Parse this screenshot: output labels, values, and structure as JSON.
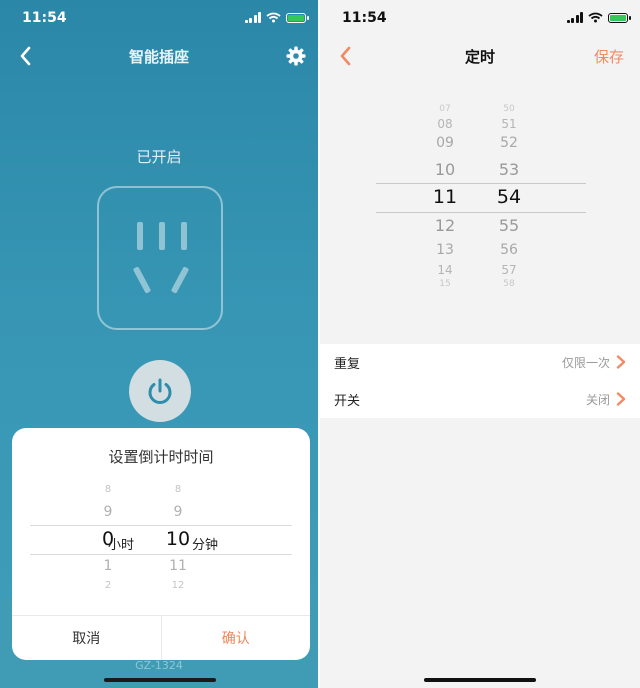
{
  "left": {
    "status": {
      "time": "11:54"
    },
    "nav": {
      "title": "智能插座"
    },
    "state_label": "已开启",
    "model_label": "GZ-1324",
    "dialog": {
      "title": "设置倒计时时间",
      "hours": {
        "above": [
          "8",
          "9"
        ],
        "selected": "0",
        "below": [
          "1",
          "2"
        ],
        "unit": "小时"
      },
      "minutes": {
        "above": [
          "8",
          "9"
        ],
        "selected": "10",
        "below": [
          "11",
          "12"
        ],
        "unit": "分钟"
      },
      "cancel_label": "取消",
      "confirm_label": "确认"
    }
  },
  "right": {
    "status": {
      "time": "11:54"
    },
    "nav": {
      "title": "定时",
      "save_label": "保存"
    },
    "hours": {
      "above": [
        "07",
        "08",
        "09",
        "10"
      ],
      "selected": "11",
      "below": [
        "12",
        "13",
        "14",
        "15"
      ]
    },
    "minutes": {
      "above": [
        "50",
        "51",
        "52",
        "53"
      ],
      "selected": "54",
      "below": [
        "55",
        "56",
        "57",
        "58"
      ]
    },
    "rows": [
      {
        "label": "重复",
        "value": "仅限一次"
      },
      {
        "label": "开关",
        "value": "关闭"
      }
    ]
  },
  "colors": {
    "accent": "#f0865a",
    "teal": "#2b87a8"
  },
  "icons": [
    "back-arrow-icon",
    "gear-icon",
    "power-icon",
    "wifi-icon",
    "signal-icon",
    "battery-icon",
    "chevron-right-icon"
  ]
}
